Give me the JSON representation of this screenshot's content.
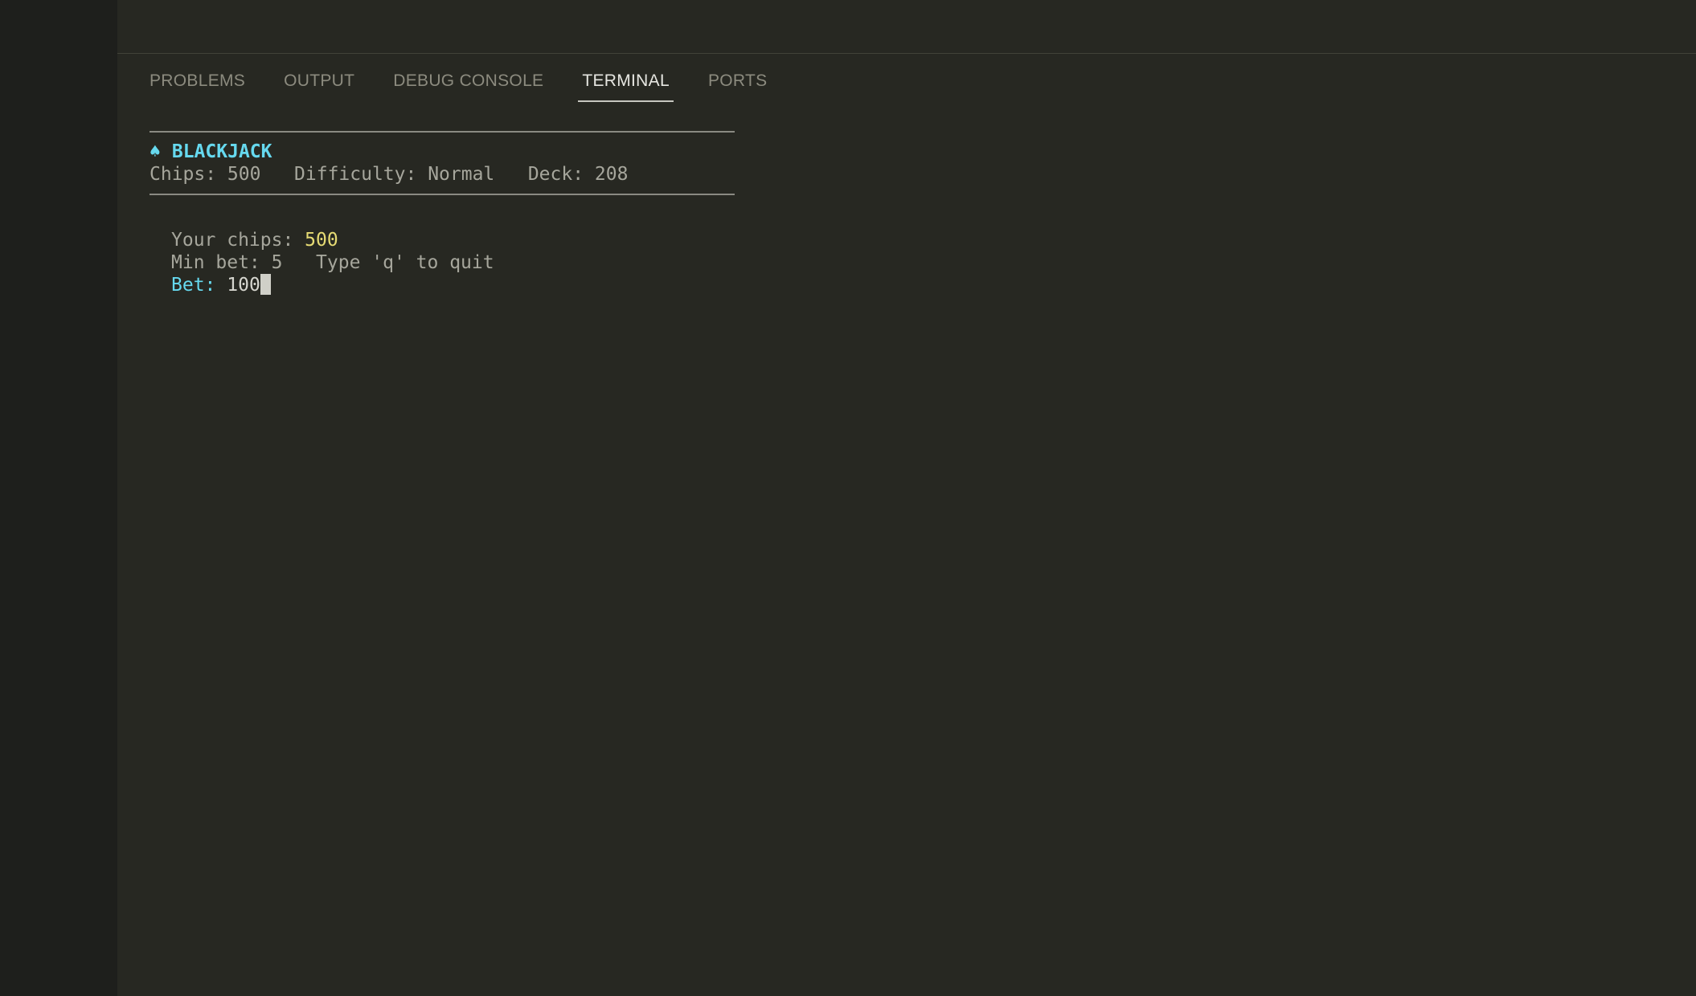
{
  "panel": {
    "tabs": [
      {
        "label": "PROBLEMS"
      },
      {
        "label": "OUTPUT"
      },
      {
        "label": "DEBUG CONSOLE"
      },
      {
        "label": "TERMINAL"
      },
      {
        "label": "PORTS"
      }
    ],
    "active_tab": "TERMINAL"
  },
  "terminal": {
    "header": {
      "suit_glyph": "♠",
      "title": "BLACKJACK",
      "chips_label": "Chips: 500",
      "difficulty_label": "Difficulty: Normal",
      "deck_label": "Deck: 208"
    },
    "prompt": {
      "chips_label": "Your chips: ",
      "chips_value": "500",
      "min_bet_label": "Min bet: 5",
      "quit_hint": "Type 'q' to quit",
      "bet_label": "Bet: ",
      "bet_input": "100"
    }
  },
  "colors": {
    "background": "#272822",
    "activity_bar": "#1e1f1c",
    "accent_cyan": "#66d9ef",
    "accent_yellow": "#e6db74",
    "text_dim": "#a6a69c"
  }
}
